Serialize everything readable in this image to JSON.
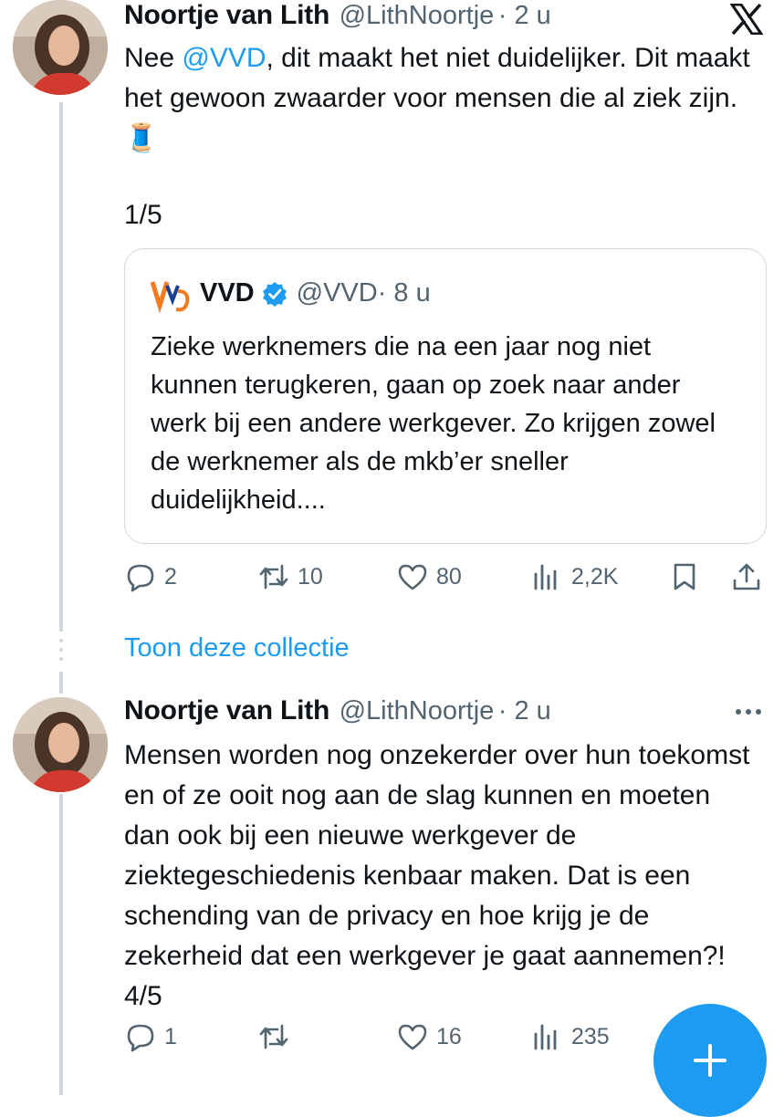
{
  "tweet1": {
    "author_name": "Noortje van Lith",
    "author_handle": "@LithNoortje",
    "time": "· 2 u",
    "text_before": "Nee ",
    "mention": "@VVD",
    "text_after": ", dit maakt het niet duidelijker. Dit maakt het gewoon zwaarder voor mensen die al ziek zijn. 🧵",
    "thread_count": "1/5",
    "quote": {
      "name": "VVD",
      "handle": "@VVD",
      "time": "· 8 u",
      "text": "Zieke werknemers die na een jaar nog niet kunnen terugkeren, gaan op zoek naar ander werk bij een andere werkgever. Zo krijgen zowel de werknemer als de mkb’er sneller duidelijkheid...."
    },
    "actions": {
      "replies": "2",
      "reposts": "10",
      "likes": "80",
      "views": "2,2K"
    }
  },
  "show_collection": "Toon deze collectie",
  "tweet2": {
    "author_name": "Noortje van Lith",
    "author_handle": "@LithNoortje",
    "time": "· 2 u",
    "text": "Mensen worden nog onzekerder over hun toekomst en of ze ooit nog aan de slag kunnen en moeten dan ook bij een nieuwe werkgever de ziektegeschiedenis kenbaar maken. Dat is een schending van de privacy en hoe krijg je de zekerheid dat een werkgever je gaat aannemen?! 4/5",
    "actions": {
      "replies": "1",
      "reposts": "",
      "likes": "16",
      "views": "235"
    }
  },
  "icons": {
    "x_logo": "x-logo-icon",
    "reply": "reply-icon",
    "repost": "repost-icon",
    "like": "heart-icon",
    "views": "views-icon",
    "bookmark": "bookmark-icon",
    "share": "share-icon",
    "more": "more-icon",
    "verified": "verified-badge-icon",
    "compose": "plus-icon"
  },
  "colors": {
    "accent": "#1d9bf0",
    "text": "#0f1419",
    "secondary": "#536471",
    "border": "#cfd9de"
  }
}
